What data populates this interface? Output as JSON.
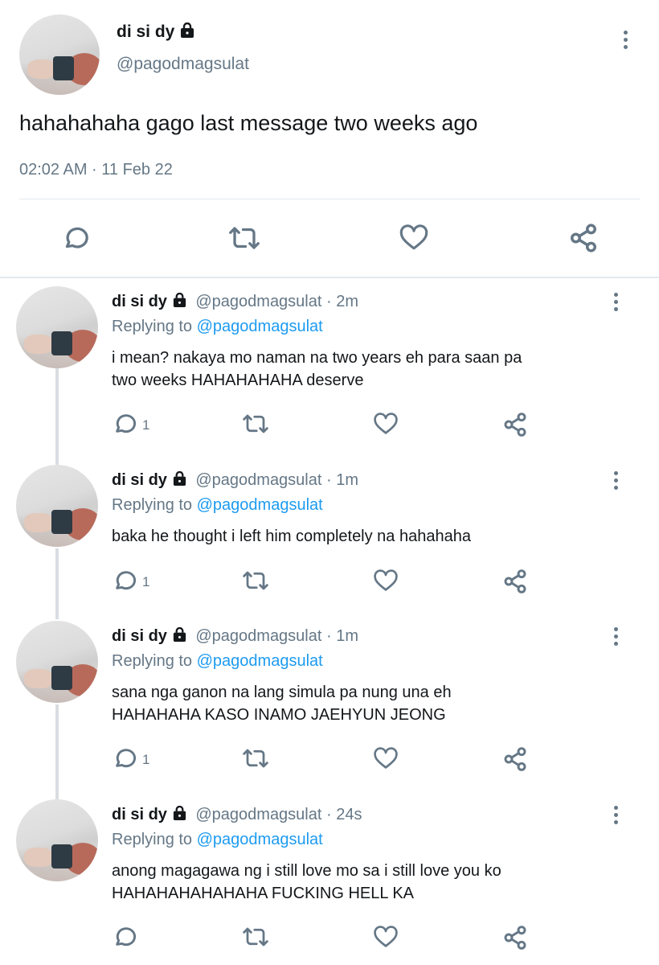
{
  "main_tweet": {
    "display_name": "di si dy",
    "handle": "@pagodmagsulat",
    "text": "hahahahaha gago last message two weeks ago",
    "timestamp": "02:02 AM · 11 Feb 22",
    "icons": [
      "reply-icon",
      "retweet-icon",
      "like-icon",
      "share-icon",
      "lock-icon",
      "more-options-icon"
    ]
  },
  "replies": [
    {
      "display_name": "di si dy",
      "handle_time": "@pagodmagsulat · 2m",
      "replying_label": "Replying to",
      "replying_handle": "@pagodmagsulat",
      "line1": "i mean? nakaya mo naman na two years eh para saan pa",
      "line2": "two weeks HAHAHAHAHA deserve",
      "reply_count": "1"
    },
    {
      "display_name": "di si dy",
      "handle_time": "@pagodmagsulat · 1m",
      "replying_label": "Replying to",
      "replying_handle": "@pagodmagsulat",
      "line1": "baka he thought i left him completely na hahahaha",
      "line2": "",
      "reply_count": "1"
    },
    {
      "display_name": "di si dy",
      "handle_time": "@pagodmagsulat · 1m",
      "replying_label": "Replying to",
      "replying_handle": "@pagodmagsulat",
      "line1": "sana nga ganon na lang simula pa nung una eh",
      "line2": "HAHAHAHA KASO INAMO JAEHYUN JEONG",
      "reply_count": "1"
    },
    {
      "display_name": "di si dy",
      "handle_time": "@pagodmagsulat · 24s",
      "replying_label": "Replying to",
      "replying_handle": "@pagodmagsulat",
      "line1": "anong magagawa ng i still love mo sa i still love you ko",
      "line2": "HAHAHAHAHAHAHA FUCKING HELL KA",
      "reply_count": ""
    }
  ],
  "colors": {
    "accent": "#1d9bf0",
    "muted": "#657786",
    "text": "#14171a",
    "divider": "#e1e8ed"
  }
}
